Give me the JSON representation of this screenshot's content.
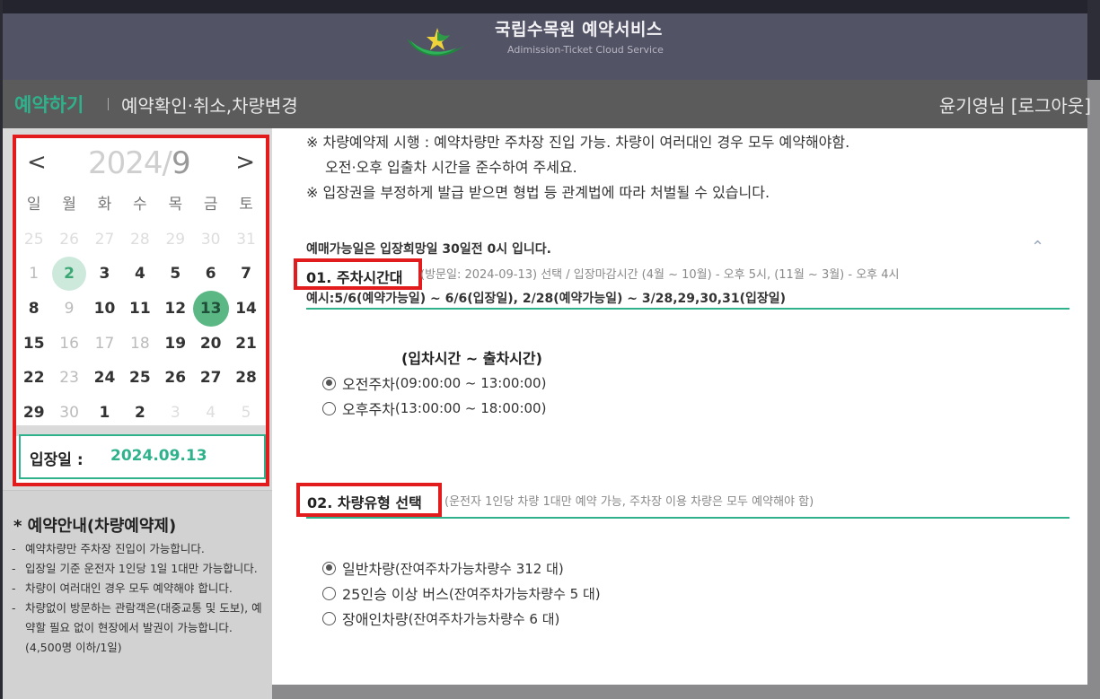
{
  "header": {
    "title": "국립수목원 예약서비스",
    "subtitle": "Adimission-Ticket Cloud Service",
    "logo_icon": "leaf-logo-icon"
  },
  "nav": {
    "book": "예약하기",
    "check": "예약확인·취소,차량변경",
    "user": "윤기영님 [로그아웃]"
  },
  "calendar": {
    "year": "2024/",
    "month": "9",
    "prev": "<",
    "next": ">",
    "weekdays": [
      "일",
      "월",
      "화",
      "수",
      "목",
      "금",
      "토"
    ],
    "weeks": [
      [
        "25",
        "26",
        "27",
        "28",
        "29",
        "30",
        "31"
      ],
      [
        "1",
        "2",
        "3",
        "4",
        "5",
        "6",
        "7"
      ],
      [
        "8",
        "9",
        "10",
        "11",
        "12",
        "13",
        "14"
      ],
      [
        "15",
        "16",
        "17",
        "18",
        "19",
        "20",
        "21"
      ],
      [
        "22",
        "23",
        "24",
        "25",
        "26",
        "27",
        "28"
      ],
      [
        "29",
        "30",
        "1",
        "2",
        "3",
        "4",
        "5"
      ]
    ],
    "today": "2",
    "selected": "13",
    "entry_label": "입장일 :",
    "entry_value": "2024.09.13"
  },
  "guide": {
    "title": "*  예약안내(차량예약제)",
    "items": [
      "예약차량만 주차장 진입이 가능합니다.",
      "입장일 기준 운전자 1인당 1일 1대만 가능합니다.",
      "차량이 여러대인 경우 모두 예약해야 합니다.",
      "차량없이 방문하는 관람객은(대중교통 및 도보), 예약할 필요 없이 현장에서 발권이 가능합니다.(4,500명 이하/1일)"
    ]
  },
  "notice": {
    "line1": "※ 차량예약제 시행 : 예약차량만 주차장 진입 가능. 차량이 여러대인 경우 모두 예약해야함.",
    "line2": "오전·오후 입출차 시간을 준수하여 주세요.",
    "line3": "※ 입장권을 부정하게 발급 받으면 형법 등 관계법에 따라 처벌될 수 있습니다."
  },
  "section1": {
    "pre": "예매가능일은 입장희망일 30일전 0시 입니다.",
    "title": "01. 주차시간대",
    "desc": "(방문일: 2024-09-13) 선택 / 입장마감시간 (4월 ~ 10월) - 오후 5시, (11월 ~ 3월) - 오후 4시",
    "example": "예시:5/6(예약가능일) ~ 6/6(입장일), 2/28(예약가능일) ~ 3/28,29,30,31(입장일)",
    "time_header": "(입차시간 ~ 출차시간)",
    "options": [
      {
        "label": "오전주차",
        "time": "(09:00:00 ~ 13:00:00)",
        "checked": true
      },
      {
        "label": "오후주차",
        "time": "(13:00:00 ~ 18:00:00)",
        "checked": false
      }
    ]
  },
  "section2": {
    "title": "02. 차량유형 선택",
    "desc": "(운전자 1인당 차량 1대만 예약 가능, 주차장 이용 차량은 모두 예약해야 함)",
    "options": [
      {
        "label": "일반차량",
        "detail": "(잔여주차가능차량수 312 대)",
        "checked": true
      },
      {
        "label": "25인승 이상 버스",
        "detail": "(잔여주차가능차량수 5 대)",
        "checked": false
      },
      {
        "label": "장애인차량",
        "detail": "(잔여주차가능차량수 6 대)",
        "checked": false
      }
    ]
  },
  "colors": {
    "accent": "#2fb28c",
    "highlight_border": "#e21c1c",
    "header_bg": "#535366",
    "nav_bg": "#5b5b5b"
  }
}
